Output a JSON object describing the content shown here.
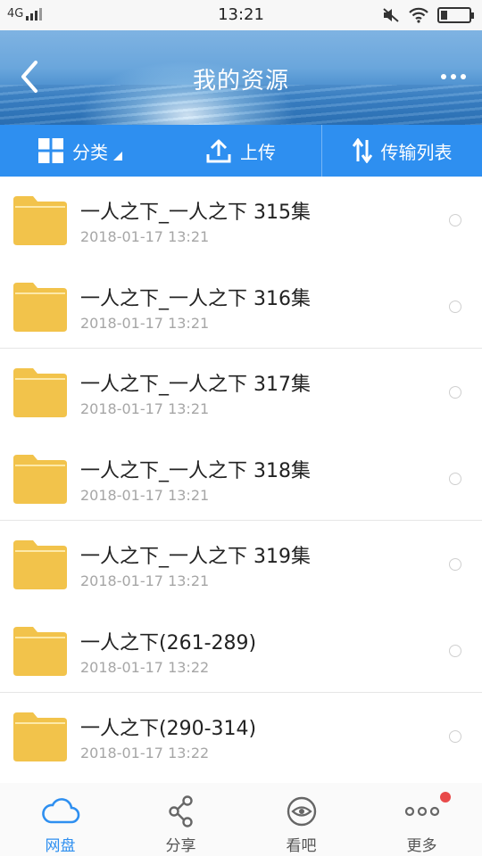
{
  "status_bar": {
    "network": "4G",
    "time": "13:21"
  },
  "header": {
    "title": "我的资源"
  },
  "toolbar": {
    "classify_label": "分类",
    "upload_label": "上传",
    "transfer_label": "传输列表"
  },
  "files": [
    {
      "name": "一人之下_一人之下 315集",
      "date": "2018-01-17  13:21"
    },
    {
      "name": "一人之下_一人之下 316集",
      "date": "2018-01-17  13:21"
    },
    {
      "name": "一人之下_一人之下 317集",
      "date": "2018-01-17  13:21"
    },
    {
      "name": "一人之下_一人之下 318集",
      "date": "2018-01-17  13:21"
    },
    {
      "name": "一人之下_一人之下 319集",
      "date": "2018-01-17  13:21"
    },
    {
      "name": "一人之下(261-289)",
      "date": "2018-01-17  13:22"
    },
    {
      "name": "一人之下(290-314)",
      "date": "2018-01-17  13:22"
    }
  ],
  "bottom_nav": [
    {
      "label": "网盘",
      "icon": "cloud-icon",
      "active": true
    },
    {
      "label": "分享",
      "icon": "share-icon",
      "active": false
    },
    {
      "label": "看吧",
      "icon": "eye-icon",
      "active": false
    },
    {
      "label": "更多",
      "icon": "more-dots-icon",
      "active": false
    }
  ],
  "colors": {
    "accent": "#2e8ff0",
    "folder": "#f2c34b",
    "badge": "#e84a4a"
  }
}
